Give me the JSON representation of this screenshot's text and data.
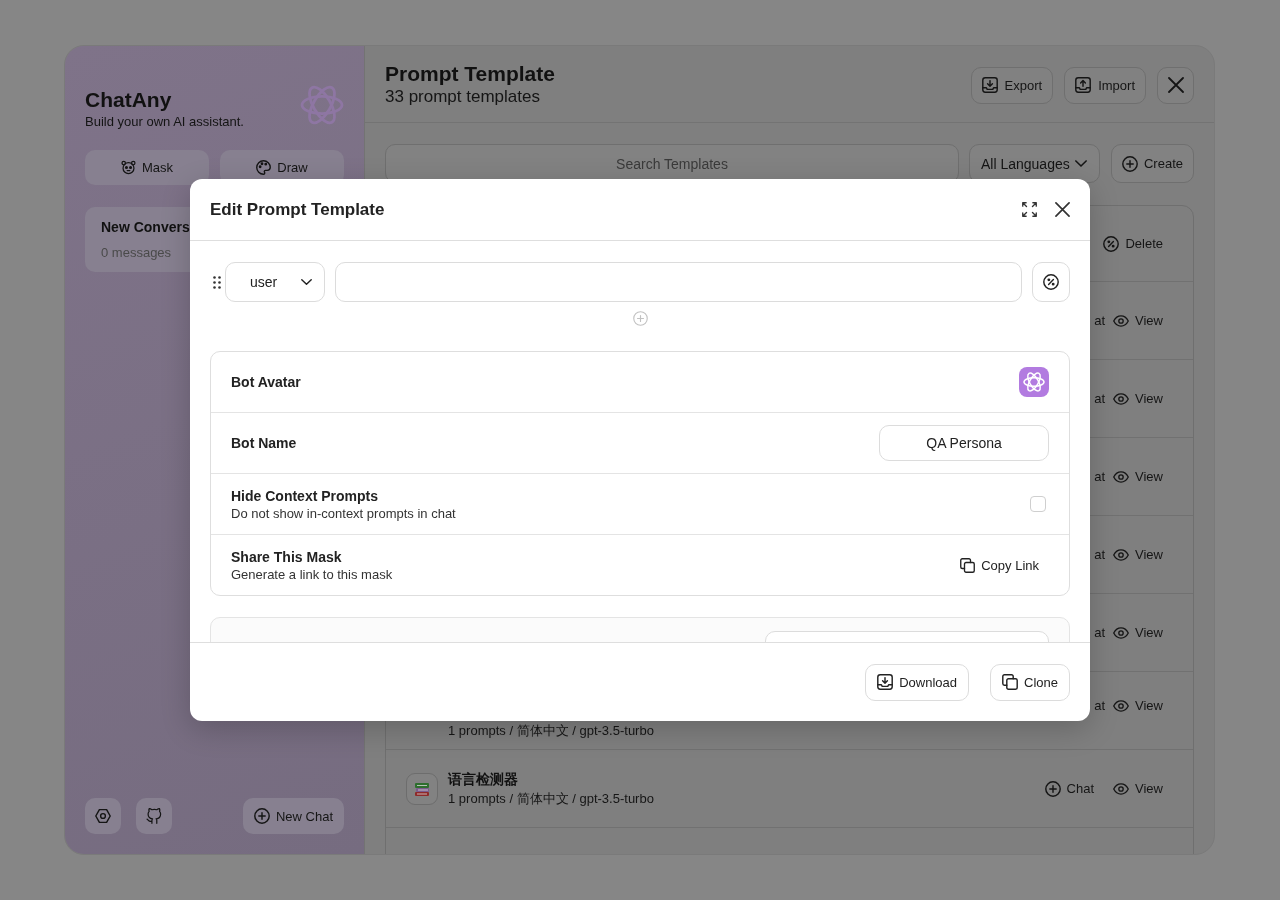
{
  "sidebar": {
    "title": "ChatAny",
    "subtitle": "Build your own AI assistant.",
    "buttons": [
      {
        "kind": "mask",
        "label": "Mask"
      },
      {
        "kind": "draw",
        "label": "Draw"
      }
    ],
    "chats": [
      {
        "title": "New Convers",
        "meta": "0 messages"
      }
    ],
    "footer_buttons": [
      {
        "kind": "settings"
      },
      {
        "kind": "repository"
      },
      {
        "kind": "new_chat",
        "label": "New Chat"
      }
    ]
  },
  "main": {
    "title": "Prompt Template",
    "subtitle": "33 prompt templates",
    "header_buttons": [
      {
        "kind": "export",
        "label": "Export"
      },
      {
        "kind": "import",
        "label": "Import"
      },
      {
        "kind": "close"
      }
    ],
    "search": {
      "placeholder": "Search Templates"
    },
    "language_select": {
      "value": "All Languages"
    },
    "create_button": {
      "label": "Create"
    },
    "templates": [
      {
        "kind": "covered",
        "actions": [
          {
            "kind": "delete",
            "label": "Delete"
          }
        ]
      },
      {
        "kind": "covered",
        "actions": [
          {
            "kind": "cut",
            "label": "at"
          },
          {
            "kind": "view",
            "label": "View"
          }
        ]
      },
      {
        "kind": "covered",
        "actions": [
          {
            "kind": "cut",
            "label": "at"
          },
          {
            "kind": "view",
            "label": "View"
          }
        ]
      },
      {
        "kind": "covered",
        "actions": [
          {
            "kind": "cut",
            "label": "at"
          },
          {
            "kind": "view",
            "label": "View"
          }
        ]
      },
      {
        "kind": "covered",
        "actions": [
          {
            "kind": "cut",
            "label": "at"
          },
          {
            "kind": "view",
            "label": "View"
          }
        ]
      },
      {
        "kind": "covered",
        "actions": [
          {
            "kind": "cut",
            "label": "at"
          },
          {
            "kind": "view",
            "label": "View"
          }
        ]
      },
      {
        "kind": "cut",
        "meta": "1 prompts / 简体中文 / gpt-3.5-turbo",
        "actions": [
          {
            "kind": "cut",
            "label": "at"
          },
          {
            "kind": "view",
            "label": "View"
          }
        ]
      },
      {
        "kind": "full",
        "title": "语言检测器",
        "meta": "1 prompts / 简体中文 / gpt-3.5-turbo",
        "actions": [
          {
            "kind": "chat",
            "label": "Chat"
          },
          {
            "kind": "view",
            "label": "View"
          }
        ]
      }
    ]
  },
  "modal": {
    "title": "Edit Prompt Template",
    "header_buttons": [
      {
        "kind": "expand"
      },
      {
        "kind": "close"
      }
    ],
    "context_prompts": [
      {
        "role": "user"
      }
    ],
    "settings": [
      {
        "kind": "avatar",
        "label": "Bot Avatar"
      },
      {
        "kind": "input",
        "label": "Bot Name",
        "value": "QA Persona"
      },
      {
        "kind": "checkbox",
        "label": "Hide Context Prompts",
        "description": "Do not show in-context prompts in chat",
        "checked": false
      },
      {
        "kind": "link",
        "label": "Share This Mask",
        "description": "Generate a link to this mask",
        "button": "Copy Link"
      }
    ],
    "footer_buttons": [
      {
        "kind": "download",
        "label": "Download"
      },
      {
        "kind": "clone",
        "label": "Clone"
      }
    ]
  }
}
